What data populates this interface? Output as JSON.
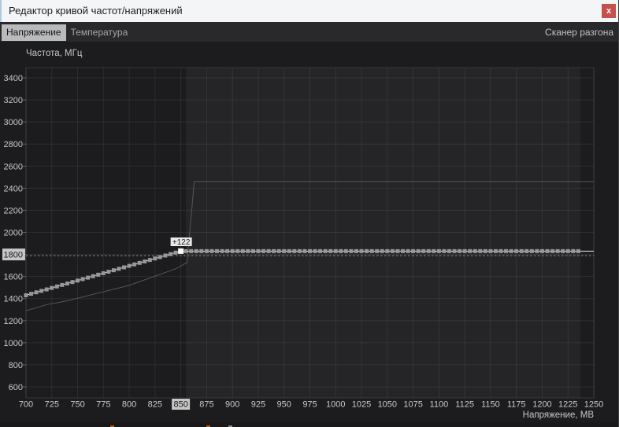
{
  "window": {
    "title": "Редактор кривой частот/напряжений",
    "close_button": "x"
  },
  "tab_bar": {
    "tabs": [
      {
        "label": "Напряжение",
        "selected": true
      },
      {
        "label": "Температура",
        "selected": false
      }
    ],
    "right_label": "Сканер разгона"
  },
  "colors": {
    "titlebar_bg": "#f4f5f6",
    "close_button_bg": "#c5504e",
    "panel_bg": "#1c1c1e",
    "tabbar_bg": "#29292b",
    "selected_tab_bg": "#b9babc",
    "axis_text": "#c9c9c9",
    "grid_line": "rgba(255,255,255,0.07)",
    "highlight_region_fill": "rgba(255,255,255,0.045)",
    "marker_fill": "#98989a",
    "selected_marker_fill": "#ffffff",
    "curve_line": "#e8e8e8",
    "reference_curve_line": "#55555b",
    "dotted_line": "#8a8a8e",
    "highlight_label_bg": "#c6c6c6",
    "highlight_label_text": "#1a1a1a",
    "tooltip_bg": "#e8e8e8",
    "tooltip_text": "#1c1c1c"
  },
  "chart_data": {
    "type": "line",
    "title": "",
    "xlabel": "Напряжение, МВ",
    "ylabel": "Частота, МГц",
    "xlim": [
      700,
      1250
    ],
    "ylim": [
      500,
      3490
    ],
    "grid": true,
    "legend": "none",
    "x_ticks": [
      700,
      725,
      750,
      775,
      800,
      825,
      850,
      875,
      900,
      925,
      950,
      975,
      1000,
      1025,
      1050,
      1075,
      1100,
      1125,
      1150,
      1175,
      1200,
      1225,
      1250
    ],
    "y_ticks": [
      600,
      800,
      1000,
      1200,
      1400,
      1600,
      1800,
      2000,
      2200,
      2400,
      2600,
      2800,
      3000,
      3200,
      3400
    ],
    "highlighted_x_tick": 850,
    "highlighted_y_tick": 1800,
    "reference_line": {
      "frequency_mhz": 1800,
      "style": "dotted"
    },
    "highlight_region": {
      "from_mv": 855,
      "to_mv": 1237
    },
    "selected_point": {
      "voltage_mv": 850,
      "frequency_mhz": 1830,
      "offset_label": "+122"
    },
    "series": [
      {
        "name": "vf-curve",
        "style": "square-markers-with-line",
        "step_mv": 5,
        "segments": [
          {
            "from": [
              700,
              1430
            ],
            "to": [
              850,
              1830
            ],
            "interpolation": "linear"
          },
          {
            "from": [
              855,
              1830
            ],
            "to": [
              1235,
              1830
            ],
            "interpolation": "flat"
          }
        ],
        "line_extends_to_mv": 1250
      },
      {
        "name": "default-curve",
        "style": "thin-line",
        "points": [
          [
            700,
            1290
          ],
          [
            720,
            1345
          ],
          [
            740,
            1380
          ],
          [
            800,
            1520
          ],
          [
            845,
            1670
          ],
          [
            856,
            1726
          ],
          [
            863,
            2460
          ],
          [
            1250,
            2460
          ]
        ]
      }
    ]
  }
}
